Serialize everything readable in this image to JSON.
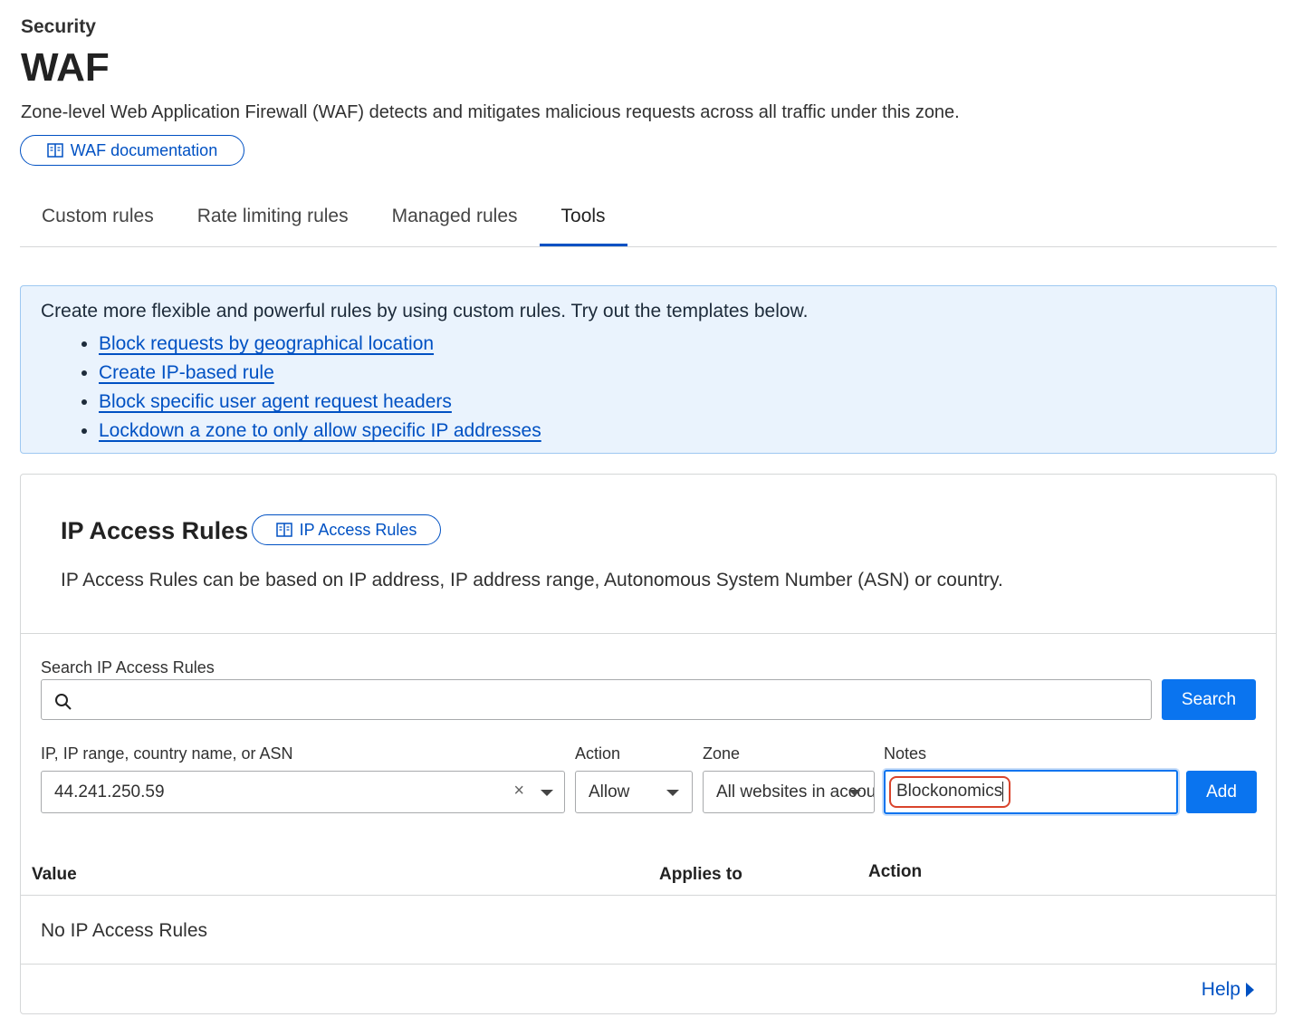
{
  "header": {
    "section": "Security",
    "title": "WAF",
    "description": "Zone-level Web Application Firewall (WAF) detects and mitigates malicious requests across all traffic under this zone.",
    "doc_button": "WAF documentation"
  },
  "tabs": [
    {
      "label": "Custom rules"
    },
    {
      "label": "Rate limiting rules"
    },
    {
      "label": "Managed rules"
    },
    {
      "label": "Tools",
      "active": true
    }
  ],
  "info": {
    "text": "Create more flexible and powerful rules by using custom rules. Try out the templates below.",
    "links": [
      "Block requests by geographical location",
      "Create IP-based rule",
      "Block specific user agent request headers",
      "Lockdown a zone to only allow specific IP addresses"
    ]
  },
  "ip_access": {
    "title": "IP Access Rules",
    "doc_button": "IP Access Rules",
    "description": "IP Access Rules can be based on IP address, IP address range, Autonomous System Number (ASN) or country.",
    "search_label": "Search IP Access Rules",
    "search_placeholder": "",
    "search_button": "Search",
    "value_label": "IP, IP range, country name, or ASN",
    "value_input": "44.241.250.59",
    "action_label": "Action",
    "action_value": "Allow",
    "zone_label": "Zone",
    "zone_value": "All websites in account",
    "notes_label": "Notes",
    "notes_value": "Blockonomics",
    "add_button": "Add",
    "columns": [
      "Value",
      "Applies to",
      "Action"
    ],
    "empty_message": "No IP Access Rules",
    "help_link": "Help"
  },
  "colors": {
    "accent": "#0051c3",
    "primary_button": "#0a74ef",
    "info_bg": "#eaf3fd",
    "highlight": "#d9442c"
  }
}
